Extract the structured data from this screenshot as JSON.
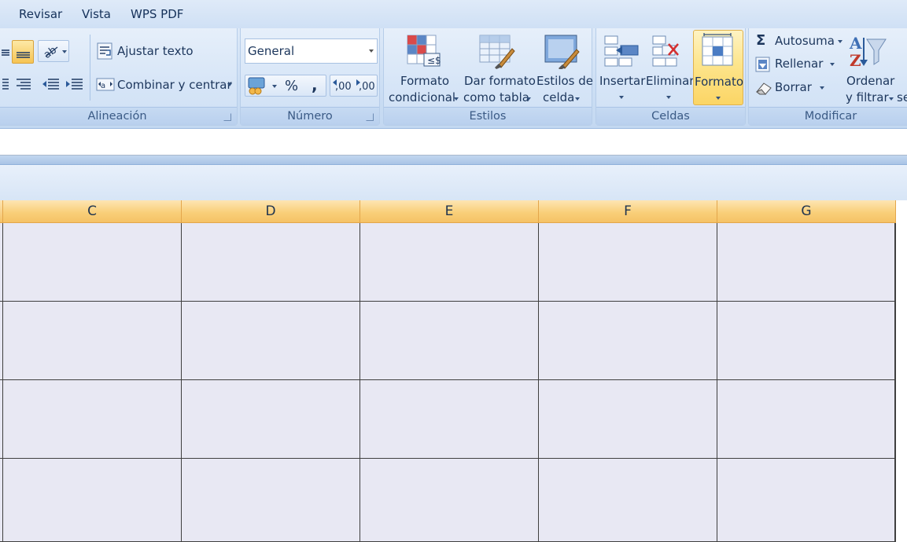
{
  "tabs": [
    "Revisar",
    "Vista",
    "WPS PDF"
  ],
  "groups": {
    "alineacion": {
      "label": "Alineación",
      "wrap_text": "Ajustar texto",
      "merge_center": "Combinar y centrar"
    },
    "numero": {
      "label": "Número",
      "format_value": "General",
      "percent": "%",
      "comma": ",",
      "inc_decimal": ",00",
      "dec_decimal": ",00"
    },
    "estilos": {
      "label": "Estilos",
      "conditional_line1": "Formato",
      "conditional_line2": "condicional",
      "table_line1": "Dar formato",
      "table_line2": "como tabla",
      "cellstyle_line1": "Estilos de",
      "cellstyle_line2": "celda"
    },
    "celdas": {
      "label": "Celdas",
      "insert": "Insertar",
      "delete": "Eliminar",
      "format": "Formato"
    },
    "modificar": {
      "label": "Modificar",
      "autosum": "Autosuma",
      "fill": "Rellenar",
      "clear": "Borrar",
      "sort_line1": "Ordenar",
      "sort_line2": "y filtrar",
      "sort_cut": "se"
    }
  },
  "columns": [
    "C",
    "D",
    "E",
    "F",
    "G"
  ],
  "colors": {
    "ribbon_bg": "#cfe0f5",
    "column_header": "#f9cf7a",
    "highlight_button": "#fde68a",
    "cell_bg": "#e8e8f3"
  }
}
